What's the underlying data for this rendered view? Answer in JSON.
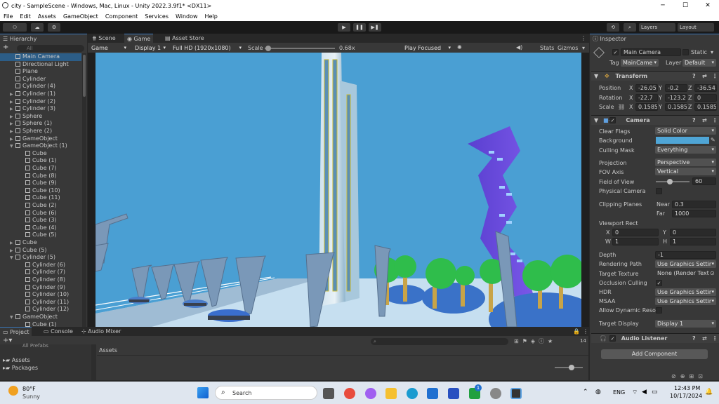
{
  "window": {
    "title": "city - SampleScene - Windows, Mac, Linux - Unity 2022.3.9f1* <DX11>",
    "min": "─",
    "max": "☐",
    "close": "✕"
  },
  "menu": [
    "File",
    "Edit",
    "Assets",
    "GameObject",
    "Component",
    "Services",
    "Window",
    "Help"
  ],
  "toolbar": {
    "account": "⚇",
    "cloud": "☁",
    "settings": "⚙",
    "play": "▶",
    "pause": "❚❚",
    "step": "▶❚",
    "history": "⟲",
    "search": "⌕",
    "layers": "Layers",
    "layout": "Layout"
  },
  "hierarchy": {
    "tab": "Hierarchy",
    "add": "+",
    "search_placeholder": "All",
    "items": [
      {
        "label": "Main Camera",
        "indent": 1,
        "arrow": "",
        "sel": true
      },
      {
        "label": "Directional Light",
        "indent": 1,
        "arrow": ""
      },
      {
        "label": "Plane",
        "indent": 1,
        "arrow": ""
      },
      {
        "label": "Cylinder",
        "indent": 1,
        "arrow": ""
      },
      {
        "label": "Cylinder (4)",
        "indent": 1,
        "arrow": ""
      },
      {
        "label": "Cylinder (1)",
        "indent": 1,
        "arrow": "▶"
      },
      {
        "label": "Cylinder (2)",
        "indent": 1,
        "arrow": "▶"
      },
      {
        "label": "Cylinder (3)",
        "indent": 1,
        "arrow": "▶"
      },
      {
        "label": "Sphere",
        "indent": 1,
        "arrow": "▶"
      },
      {
        "label": "Sphere (1)",
        "indent": 1,
        "arrow": "▶"
      },
      {
        "label": "Sphere (2)",
        "indent": 1,
        "arrow": "▶"
      },
      {
        "label": "GameObject",
        "indent": 1,
        "arrow": "▶"
      },
      {
        "label": "GameObject (1)",
        "indent": 1,
        "arrow": "▼"
      },
      {
        "label": "Cube",
        "indent": 2,
        "arrow": ""
      },
      {
        "label": "Cube (1)",
        "indent": 2,
        "arrow": ""
      },
      {
        "label": "Cube (7)",
        "indent": 2,
        "arrow": ""
      },
      {
        "label": "Cube (8)",
        "indent": 2,
        "arrow": ""
      },
      {
        "label": "Cube (9)",
        "indent": 2,
        "arrow": ""
      },
      {
        "label": "Cube (10)",
        "indent": 2,
        "arrow": ""
      },
      {
        "label": "Cube (11)",
        "indent": 2,
        "arrow": ""
      },
      {
        "label": "Cube (2)",
        "indent": 2,
        "arrow": ""
      },
      {
        "label": "Cube (6)",
        "indent": 2,
        "arrow": ""
      },
      {
        "label": "Cube (3)",
        "indent": 2,
        "arrow": ""
      },
      {
        "label": "Cube (4)",
        "indent": 2,
        "arrow": ""
      },
      {
        "label": "Cube (5)",
        "indent": 2,
        "arrow": ""
      },
      {
        "label": "Cube",
        "indent": 1,
        "arrow": "▶"
      },
      {
        "label": "Cube (5)",
        "indent": 1,
        "arrow": "▶"
      },
      {
        "label": "Cylinder (5)",
        "indent": 1,
        "arrow": "▼"
      },
      {
        "label": "Cylinder (6)",
        "indent": 2,
        "arrow": ""
      },
      {
        "label": "Cylinder (7)",
        "indent": 2,
        "arrow": ""
      },
      {
        "label": "Cylinder (8)",
        "indent": 2,
        "arrow": ""
      },
      {
        "label": "Cylinder (9)",
        "indent": 2,
        "arrow": ""
      },
      {
        "label": "Cylinder (10)",
        "indent": 2,
        "arrow": ""
      },
      {
        "label": "Cylinder (11)",
        "indent": 2,
        "arrow": ""
      },
      {
        "label": "Cylinder (12)",
        "indent": 2,
        "arrow": ""
      },
      {
        "label": "GameObject",
        "indent": 1,
        "arrow": "▼"
      },
      {
        "label": "Cube (1)",
        "indent": 2,
        "arrow": ""
      }
    ]
  },
  "viewtabs": {
    "scene": "Scene",
    "game": "Game",
    "asset_store": "Asset Store"
  },
  "gamebar": {
    "display_mode": "Game",
    "display": "Display 1",
    "resolution": "Full HD (1920x1080)",
    "scale_label": "Scale",
    "scale_value": "0.68x",
    "scale_fraction": 0.05,
    "play_focused": "Play Focused",
    "stats": "Stats",
    "gizmos": "Gizmos"
  },
  "inspector": {
    "tab": "Inspector",
    "object_name": "Main Camera",
    "static": "Static",
    "tag_label": "Tag",
    "tag": "MainCame",
    "layer_label": "Layer",
    "layer": "Default",
    "transform": {
      "title": "Transform",
      "position": "Position",
      "rotation": "Rotation",
      "scale": "Scale",
      "pos": [
        "-26.05",
        "-0.2",
        "-36.54"
      ],
      "rot": [
        "-22.7",
        "-123.2",
        "0"
      ],
      "scl": [
        "0.1585",
        "0.1585",
        "0.1585"
      ],
      "x": "X",
      "y": "Y",
      "z": "Z"
    },
    "camera": {
      "title": "Camera",
      "clear_flags": "Clear Flags",
      "clear_flags_val": "Solid Color",
      "background": "Background",
      "background_color": "#4fa5d6",
      "culling_mask": "Culling Mask",
      "culling_mask_val": "Everything",
      "projection": "Projection",
      "projection_val": "Perspective",
      "fov_axis": "FOV Axis",
      "fov_axis_val": "Vertical",
      "fov": "Field of View",
      "fov_val": "60",
      "fov_fraction": 0.12,
      "physical": "Physical Camera",
      "clipping": "Clipping Planes",
      "near": "Near",
      "near_val": "0.3",
      "far": "Far",
      "far_val": "1000",
      "viewport": "Viewport Rect",
      "vx": "X",
      "vx_val": "0",
      "vy": "Y",
      "vy_val": "0",
      "vw": "W",
      "vw_val": "1",
      "vh": "H",
      "vh_val": "1",
      "depth": "Depth",
      "depth_val": "-1",
      "rendering_path": "Rendering Path",
      "rendering_path_val": "Use Graphics Settir",
      "target_texture": "Target Texture",
      "target_texture_val": "None (Render Text",
      "occlusion": "Occlusion Culling",
      "hdr": "HDR",
      "hdr_val": "Use Graphics Settir",
      "msaa": "MSAA",
      "msaa_val": "Use Graphics Settir",
      "dynres": "Allow Dynamic Reso",
      "target_display": "Target Display",
      "target_display_val": "Display 1"
    },
    "audio": {
      "title": "Audio Listener"
    },
    "add_component": "Add Component"
  },
  "bottom": {
    "project": "Project",
    "console": "Console",
    "audio_mixer": "Audio Mixer",
    "all_prefabs": "All Prefabs",
    "assets": "Assets",
    "packages": "Packages",
    "assets_header": "Assets",
    "count": "14",
    "search_placeholder": "⌕"
  },
  "taskbar": {
    "temp": "80°F",
    "weather": "Sunny",
    "search": "Search",
    "lang": "ENG",
    "time": "12:43 PM",
    "date": "10/17/2024",
    "badge": "1"
  }
}
